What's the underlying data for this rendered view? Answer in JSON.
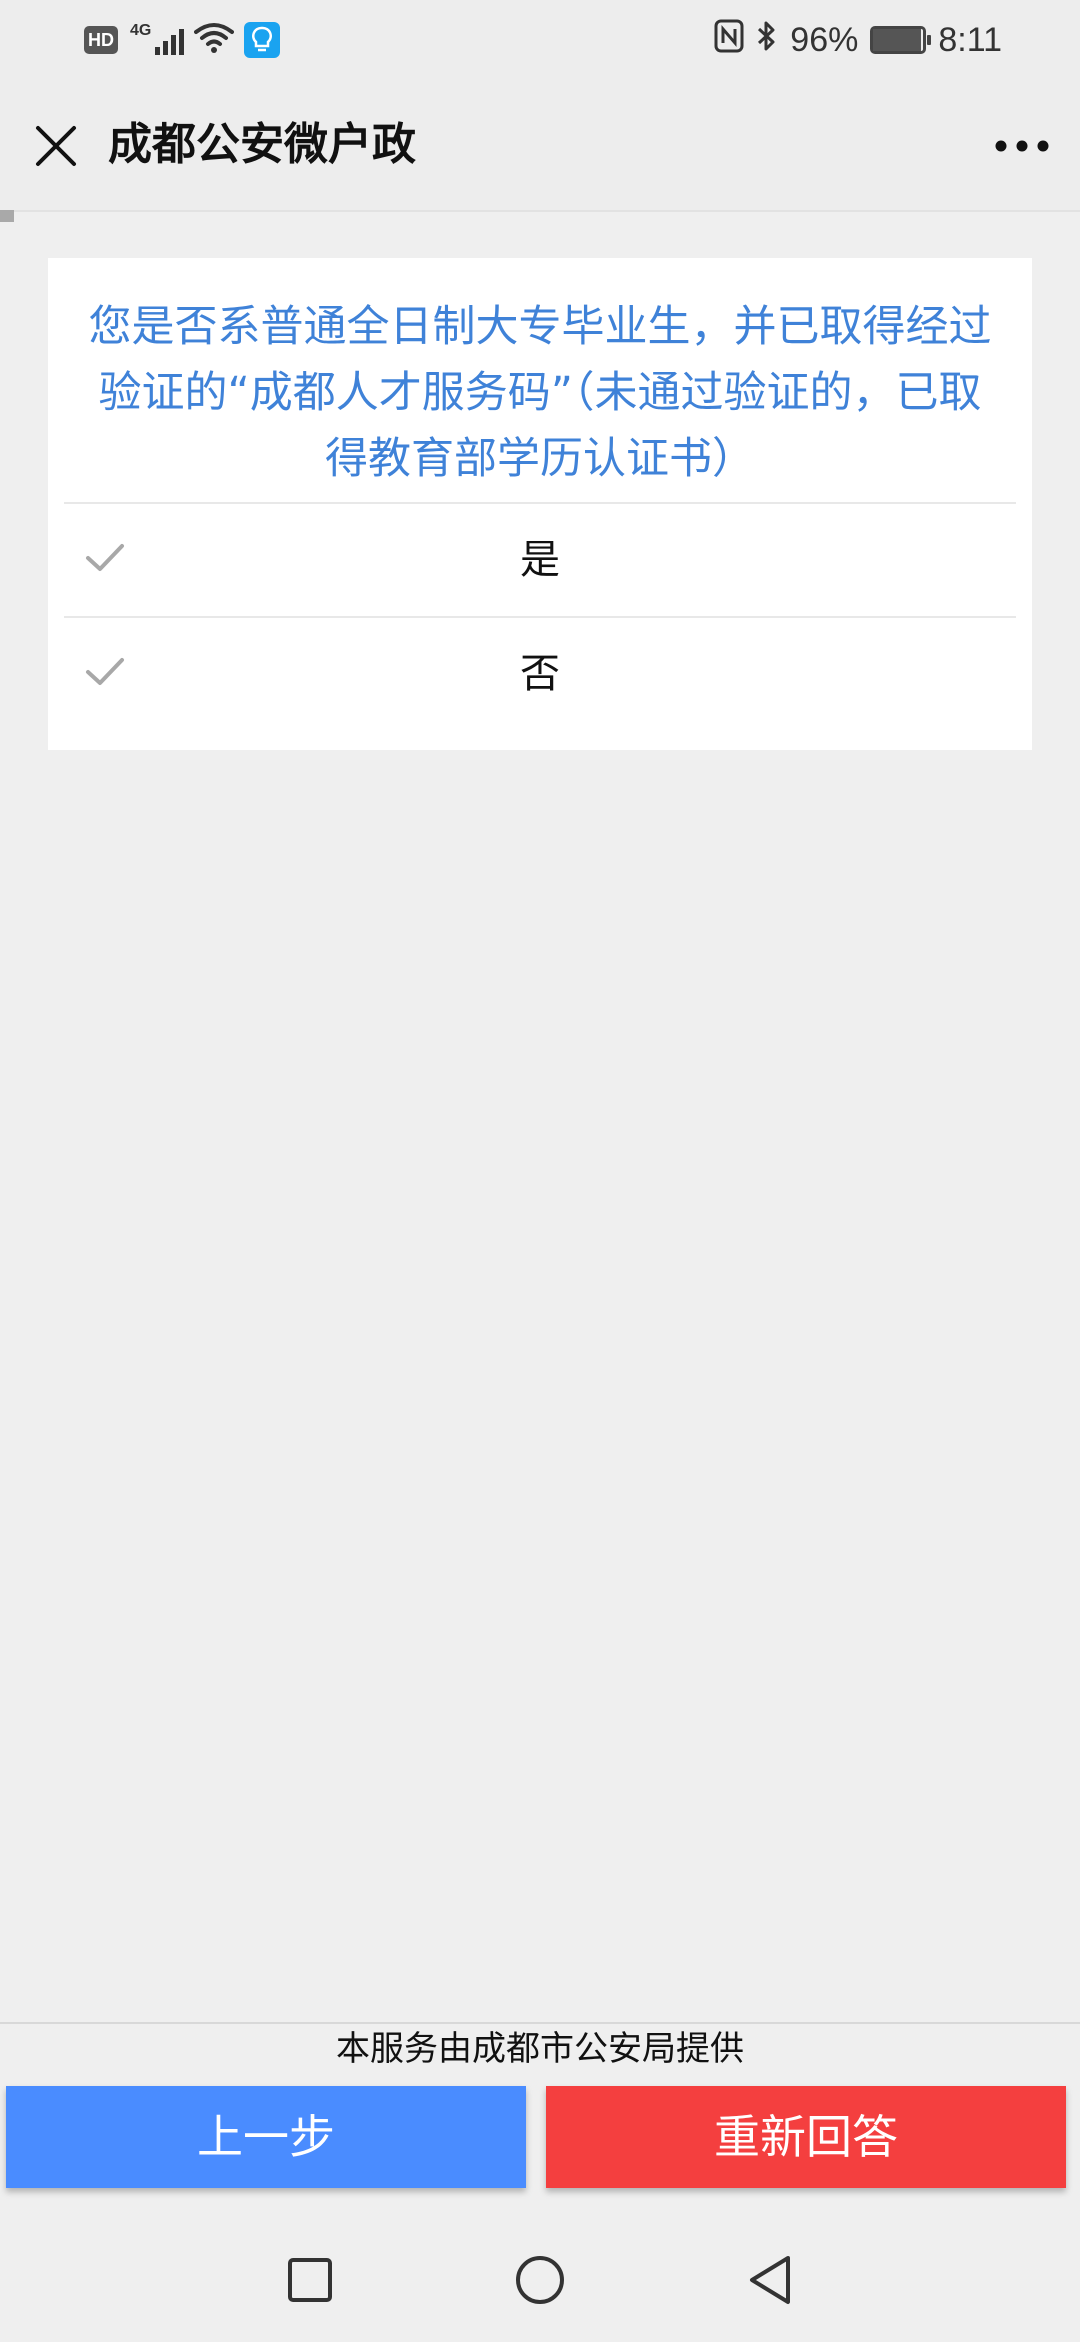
{
  "status_bar": {
    "hd_label": "HD",
    "network_label": "4G",
    "battery_percent": "96%",
    "battery_level": 0.96,
    "time": "8:11",
    "icons": [
      "hd-icon",
      "signal-icon",
      "wifi-icon",
      "bulb-icon",
      "nfc-icon",
      "bluetooth-icon",
      "battery-icon"
    ]
  },
  "header": {
    "title": "成都公安微户政",
    "close_icon": "close-icon",
    "more_icon": "more-icon"
  },
  "question": {
    "text": "您是否系普通全日制大专毕业生，并已取得经过验证的“成都人才服务码”（未通过验证的，已取得教育部学历认证书）",
    "options": [
      {
        "label": "是",
        "icon": "check-icon"
      },
      {
        "label": "否",
        "icon": "check-icon"
      }
    ]
  },
  "footer": {
    "provider": "本服务由成都市公安局提供",
    "prev_label": "上一步",
    "restart_label": "重新回答"
  },
  "colors": {
    "question_text": "#3f82d8",
    "prev_button": "#4a8cff",
    "restart_button": "#f43f3f",
    "background": "#efefef"
  },
  "nav_bar": {
    "icons": [
      "recents-square-icon",
      "home-circle-icon",
      "back-triangle-icon"
    ]
  }
}
